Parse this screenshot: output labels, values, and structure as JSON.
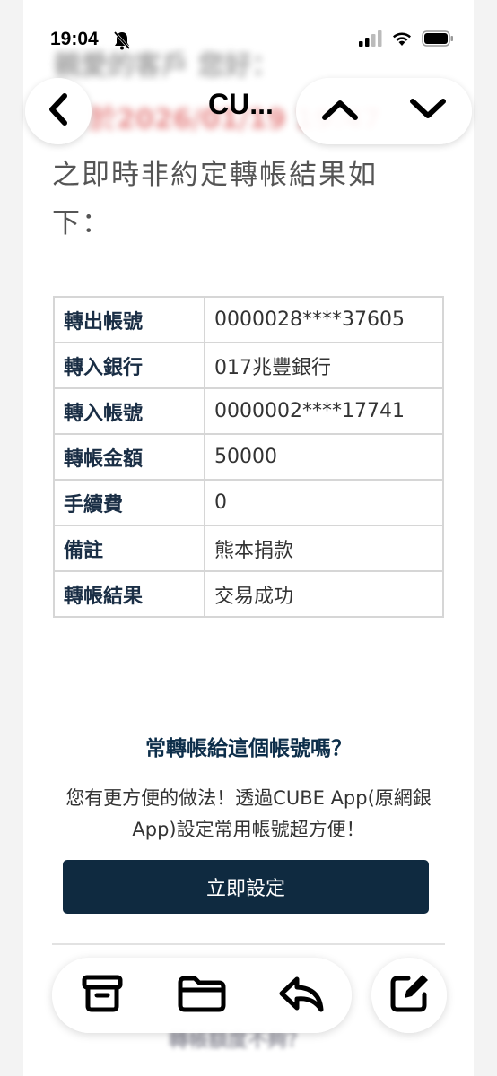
{
  "status_bar": {
    "time": "19:04"
  },
  "nav": {
    "title": "CU...",
    "back_icon": "chevron-left-icon",
    "prev_icon": "chevron-up-icon",
    "next_icon": "chevron-down-icon"
  },
  "blurred_header": {
    "greeting": "親愛的客戶 您好：",
    "date_line": "於2026/01/19 19:47"
  },
  "intro": {
    "text": "之即時非約定轉帳結果如下："
  },
  "transfer_details": [
    {
      "label": "轉出帳號",
      "value": "0000028****37605"
    },
    {
      "label": "轉入銀行",
      "value": "017兆豐銀行"
    },
    {
      "label": "轉入帳號",
      "value": "0000002****17741"
    },
    {
      "label": "轉帳金額",
      "value": "50000"
    },
    {
      "label": "手續費",
      "value": "0"
    },
    {
      "label": "備註",
      "value": "熊本捐款"
    },
    {
      "label": "轉帳結果",
      "value": "交易成功"
    }
  ],
  "promo": {
    "title": "常轉帳給這個帳號嗎？",
    "text": "您有更方便的做法！透過CUBE App(原網銀App)設定常用帳號超方便！",
    "button_label": "立即設定"
  },
  "blurred_footer": {
    "text": "轉帳額度不夠？"
  },
  "toolbar": {
    "archive_icon": "archive-icon",
    "folder_icon": "folder-icon",
    "reply_icon": "reply-icon",
    "compose_icon": "compose-icon"
  },
  "colors": {
    "button_bg": "#0f2a40",
    "label_text": "#1a2e45",
    "promo_title": "#0d2e4a"
  }
}
